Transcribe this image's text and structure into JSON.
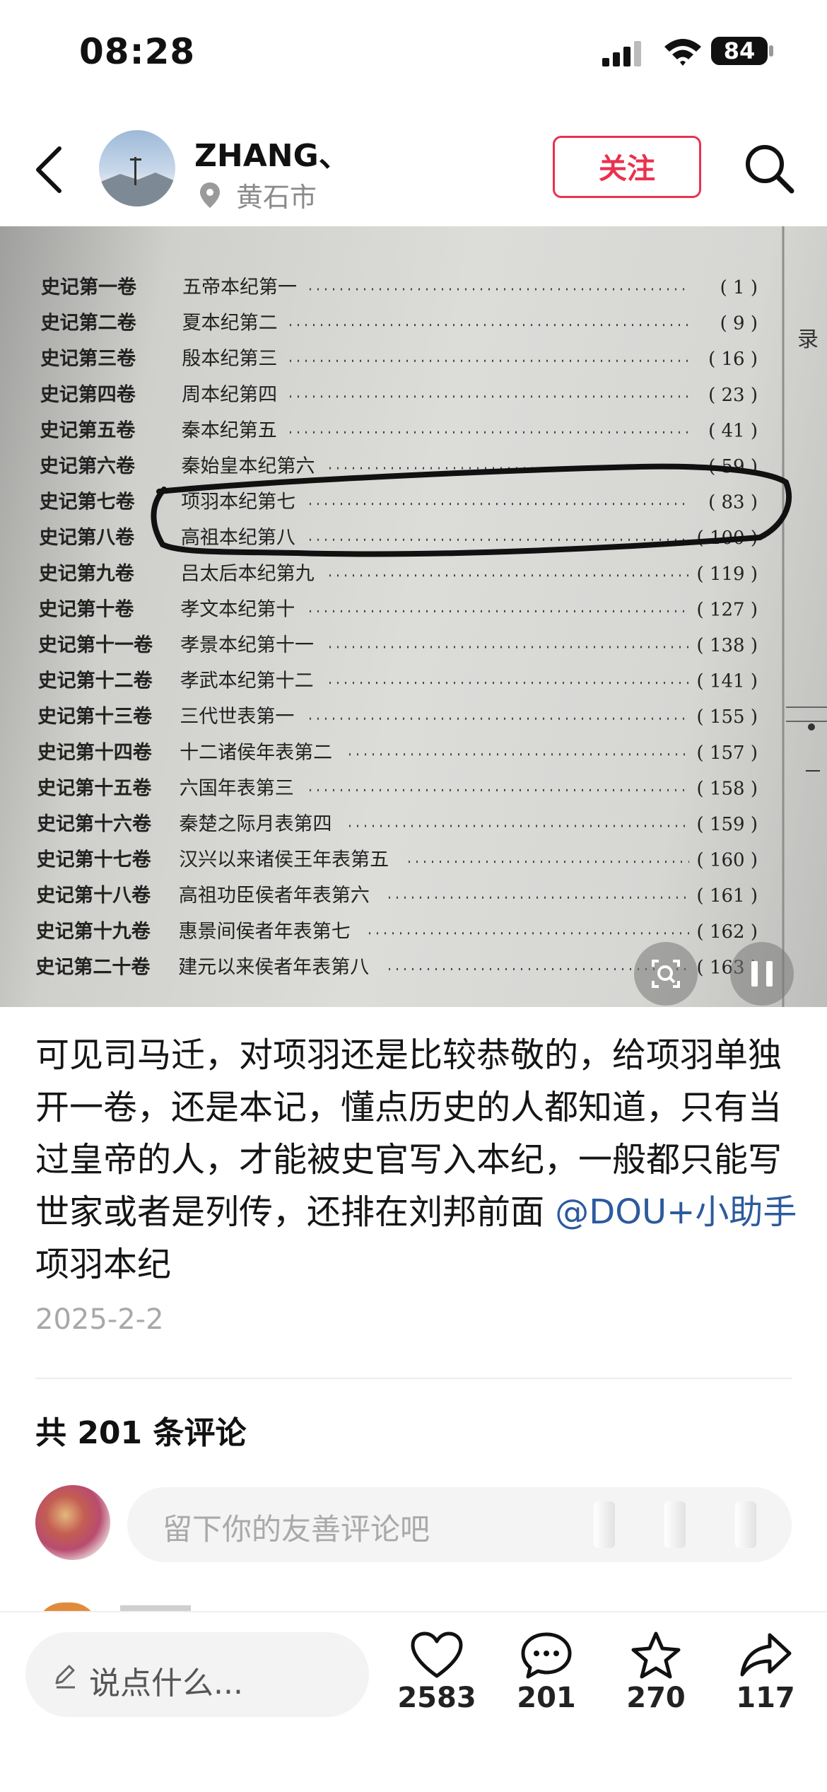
{
  "status_bar": {
    "time": "08:28",
    "battery": "84"
  },
  "header": {
    "username": "ZHANG、",
    "location": "黄石市",
    "follow_label": "关注"
  },
  "photo": {
    "page_title_partial": "录",
    "toc": [
      {
        "volume": "史记第一卷",
        "title": "五帝本纪第一",
        "page": "( 1 )"
      },
      {
        "volume": "史记第二卷",
        "title": "夏本纪第二",
        "page": "( 9 )"
      },
      {
        "volume": "史记第三卷",
        "title": "殷本纪第三",
        "page": "( 16 )"
      },
      {
        "volume": "史记第四卷",
        "title": "周本纪第四",
        "page": "( 23 )"
      },
      {
        "volume": "史记第五卷",
        "title": "秦本纪第五",
        "page": "( 41 )"
      },
      {
        "volume": "史记第六卷",
        "title": "秦始皇本纪第六",
        "page": "( 59 )"
      },
      {
        "volume": "史记第七卷",
        "title": "项羽本纪第七",
        "page": "( 83 )"
      },
      {
        "volume": "史记第八卷",
        "title": "高祖本纪第八",
        "page": "( 100 )"
      },
      {
        "volume": "史记第九卷",
        "title": "吕太后本纪第九",
        "page": "( 119 )"
      },
      {
        "volume": "史记第十卷",
        "title": "孝文本纪第十",
        "page": "( 127 )"
      },
      {
        "volume": "史记第十一卷",
        "title": "孝景本纪第十一",
        "page": "( 138 )"
      },
      {
        "volume": "史记第十二卷",
        "title": "孝武本纪第十二",
        "page": "( 141 )"
      },
      {
        "volume": "史记第十三卷",
        "title": "三代世表第一",
        "page": "( 155 )"
      },
      {
        "volume": "史记第十四卷",
        "title": "十二诸侯年表第二",
        "page": "( 157 )"
      },
      {
        "volume": "史记第十五卷",
        "title": "六国年表第三",
        "page": "( 158 )"
      },
      {
        "volume": "史记第十六卷",
        "title": "秦楚之际月表第四",
        "page": "( 159 )"
      },
      {
        "volume": "史记第十七卷",
        "title": "汉兴以来诸侯王年表第五",
        "page": "( 160 )"
      },
      {
        "volume": "史记第十八卷",
        "title": "高祖功臣侯者年表第六",
        "page": "( 161 )"
      },
      {
        "volume": "史记第十九卷",
        "title": "惠景间侯者年表第七",
        "page": "( 162 )"
      },
      {
        "volume": "史记第二十卷",
        "title": "建元以来侯者年表第八",
        "page": "( 163 )"
      }
    ]
  },
  "post": {
    "caption": "可见司马迁，对项羽还是比较恭敬的，给项羽单独开一卷，还是本记，懂点历史的人都知道，只有当过皇帝的人，才能被史官写入本纪，一般都只能写世家或者是列传，还排在刘邦前面",
    "mention": "@DOU+小助手",
    "tag_text": "项羽本纪",
    "date": "2025-2-2"
  },
  "comments": {
    "count_label": "共 201 条评论",
    "input_placeholder": "留下你的友善评论吧"
  },
  "bottom_bar": {
    "say_placeholder": "说点什么...",
    "likes": "2583",
    "comments": "201",
    "favorites": "270",
    "shares": "117"
  },
  "icons": [
    "back-icon",
    "location-pin-icon",
    "search-icon",
    "screenshot-search-icon",
    "pause-icon",
    "edit-icon",
    "heart-icon",
    "comment-icon",
    "star-icon",
    "share-icon",
    "signal-icon",
    "wifi-icon"
  ],
  "colors": {
    "follow": "#e8324f",
    "mention": "#2d5a9e"
  }
}
